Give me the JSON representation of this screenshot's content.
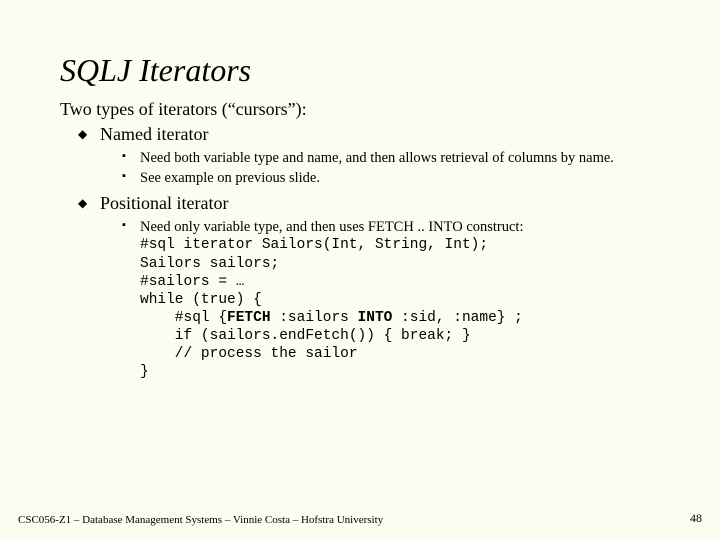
{
  "title": "SQLJ Iterators",
  "intro": "Two types of iterators (“cursors”):",
  "items": [
    {
      "label": "Named iterator",
      "sub": [
        "Need both variable type and name, and then allows retrieval of columns by name.",
        "See example on previous slide."
      ]
    },
    {
      "label": "Positional iterator",
      "sub_lead": "Need only variable type, and then uses FETCH .. INTO construct:",
      "code": {
        "l1": "#sql iterator Sailors(Int, String, Int);",
        "l2": "Sailors sailors;",
        "l3": "#sailors = …",
        "l4": "while (true) {",
        "l5a": "    #sql {",
        "l5b": "FETCH",
        "l5c": " :sailors ",
        "l5d": "INTO",
        "l5e": " :sid, :name} ;",
        "l6": "    if (sailors.endFetch()) { break; }",
        "l7": "    // process the sailor",
        "l8": "}"
      }
    }
  ],
  "footer": "CSC056-Z1 – Database Management Systems – Vinnie Costa – Hofstra University",
  "page": "48"
}
